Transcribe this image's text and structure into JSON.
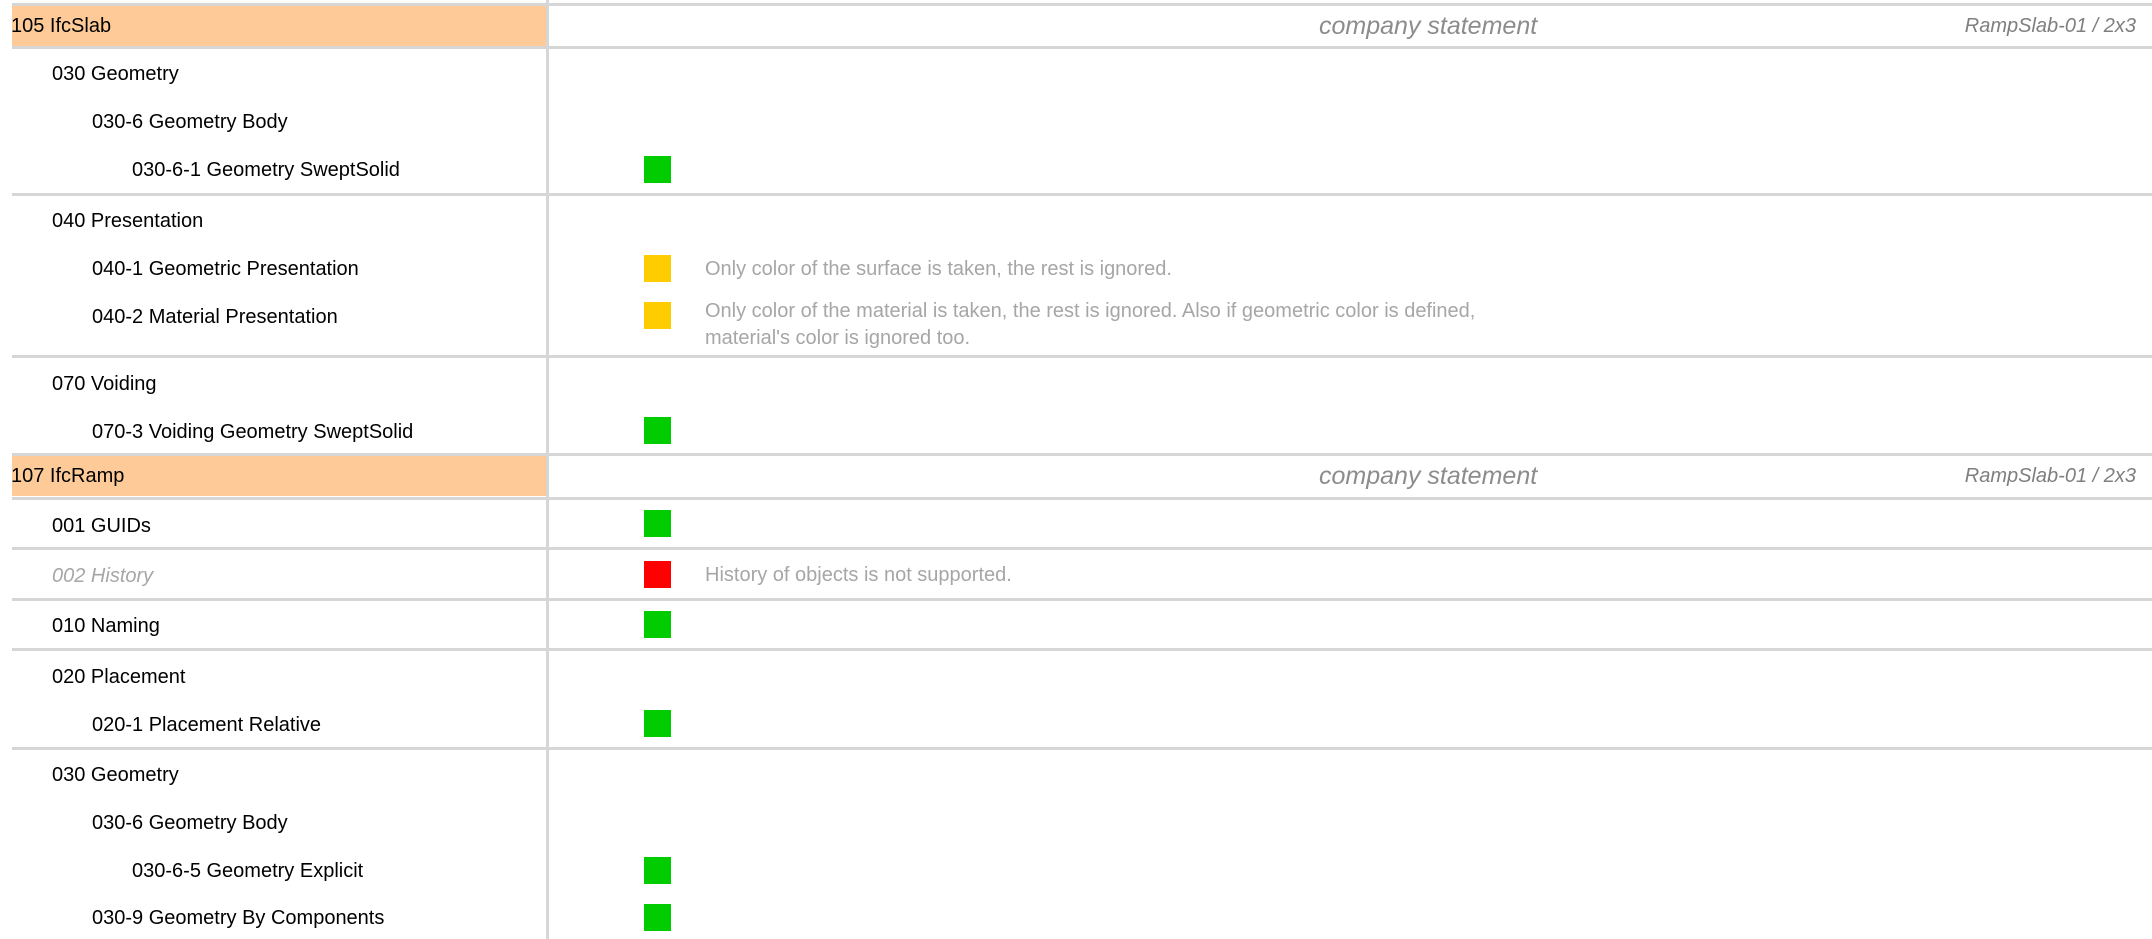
{
  "colors": {
    "ok": "#00cc00",
    "partial": "#ffcc00",
    "unsupported": "#ff0000",
    "header_bg": "#fecb98"
  },
  "sections": [
    {
      "title": "105 IfcSlab",
      "company_statement": "company statement",
      "reference": "RampSlab-01 / 2x3",
      "items": [
        {
          "label": "030 Geometry",
          "level": 1
        },
        {
          "label": "030-6 Geometry Body",
          "level": 2
        },
        {
          "label": "030-6-1 Geometry SweptSolid",
          "level": 3,
          "status": "ok"
        },
        {
          "label": "040 Presentation",
          "level": 1
        },
        {
          "label": "040-1 Geometric Presentation",
          "level": 2,
          "status": "partial",
          "note": "Only color of the surface is taken, the rest is ignored."
        },
        {
          "label": "040-2 Material Presentation",
          "level": 2,
          "status": "partial",
          "note": "Only color of the material is taken, the rest is ignored.  Also if geometric color is defined, material's color is ignored too."
        },
        {
          "label": "070 Voiding",
          "level": 1
        },
        {
          "label": "070-3 Voiding Geometry SweptSolid",
          "level": 2,
          "status": "ok"
        }
      ]
    },
    {
      "title": "107 IfcRamp",
      "company_statement": "company statement",
      "reference": "RampSlab-01 / 2x3",
      "items": [
        {
          "label": "001 GUIDs",
          "level": 1,
          "status": "ok"
        },
        {
          "label": "002 History",
          "level": 1,
          "status": "unsupported",
          "note": "History of objects is not supported."
        },
        {
          "label": "010 Naming",
          "level": 1,
          "status": "ok"
        },
        {
          "label": "020 Placement",
          "level": 1
        },
        {
          "label": "020-1 Placement Relative",
          "level": 2,
          "status": "ok"
        },
        {
          "label": "030 Geometry",
          "level": 1
        },
        {
          "label": "030-6 Geometry Body",
          "level": 2
        },
        {
          "label": "030-6-5 Geometry Explicit",
          "level": 3,
          "status": "ok"
        },
        {
          "label": "030-9 Geometry By Components",
          "level": 2,
          "status": "ok"
        }
      ]
    }
  ]
}
